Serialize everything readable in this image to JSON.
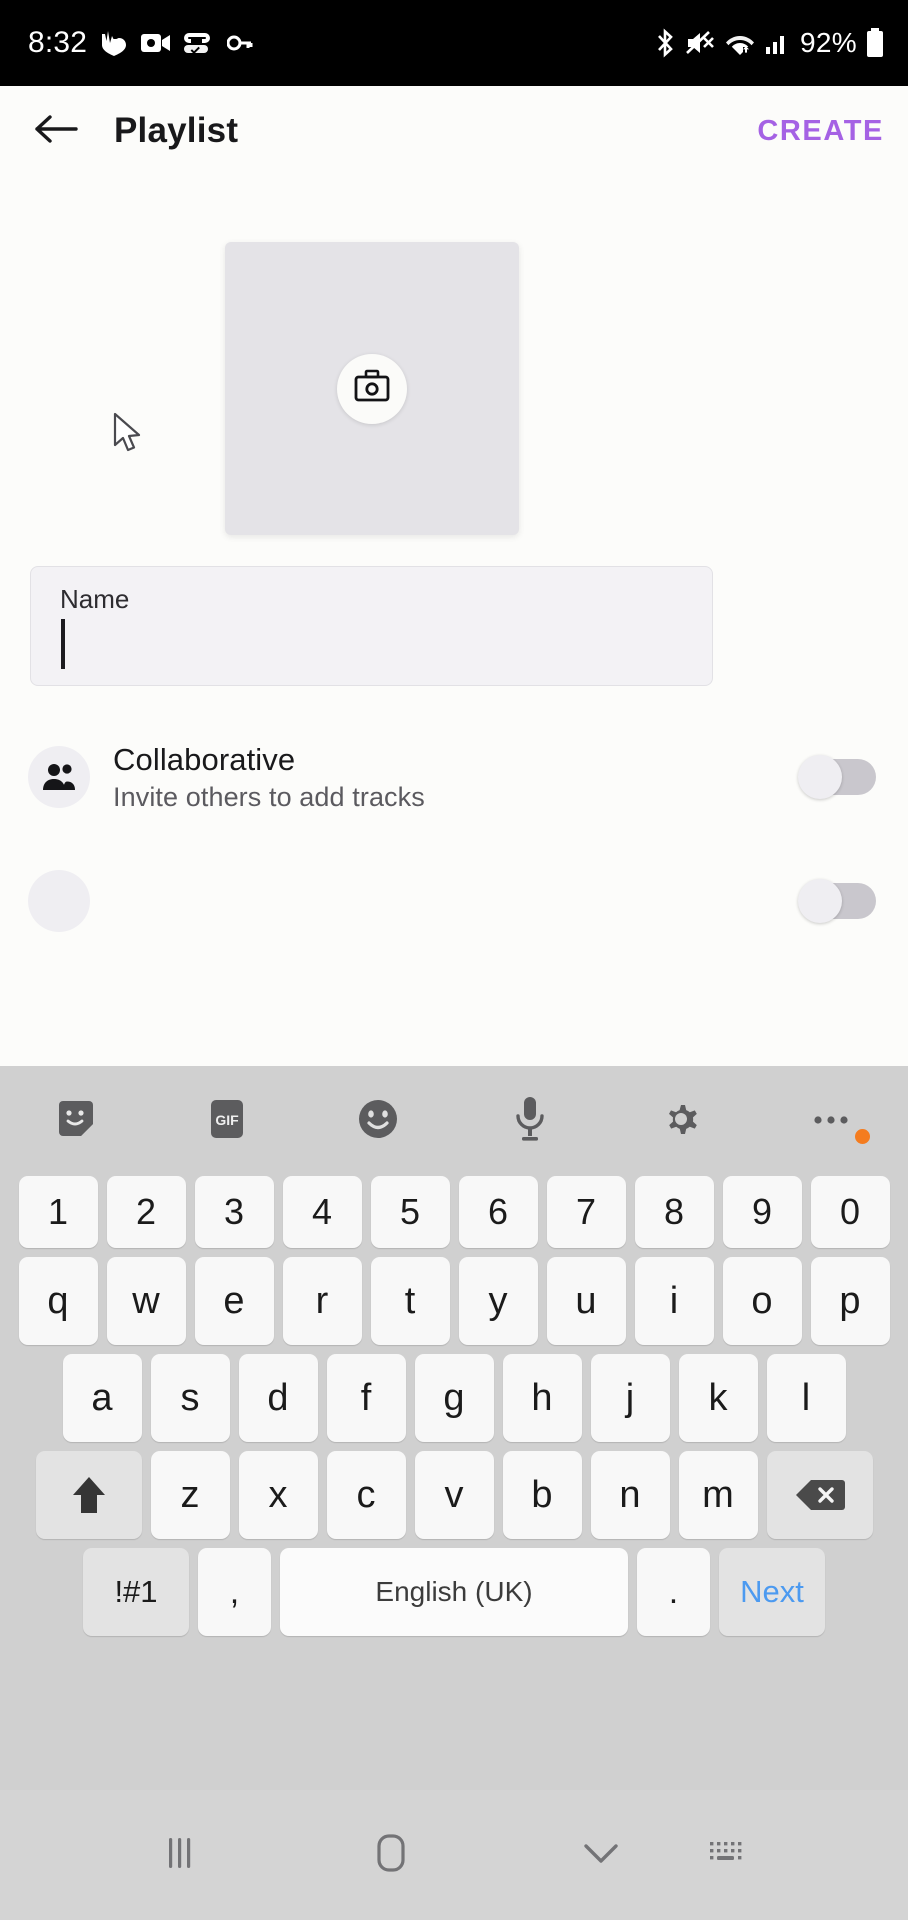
{
  "theme": {
    "accent": "#A562E4",
    "page_bg": "#FCFCFA",
    "cover_bg": "#E4E3E7",
    "field_bg": "#F3F2F5",
    "keyboard_bg": "#D0D0D0",
    "key_bg": "#F8F8F8",
    "key_fn_bg": "#E3E3E3",
    "navbar_bg": "#D4D4D4",
    "next_key_color": "#4C9AF0",
    "badge_dot": "#F47C1F"
  },
  "status_bar": {
    "time": "8:32",
    "battery_percent": "92%",
    "left_icons": [
      "heart-beat-icon",
      "video-camera-icon",
      "vpn-key-link-icon",
      "key-icon"
    ],
    "right_icons": [
      "bluetooth-icon",
      "mute-icon",
      "wifi-icon",
      "cellular-signal-icon"
    ],
    "battery_icon": "battery-icon"
  },
  "app_bar": {
    "back_icon": "back-arrow-icon",
    "title": "Playlist",
    "create_label": "CREATE"
  },
  "main": {
    "cover": {
      "name": "playlist-cover-placeholder",
      "camera_icon": "camera-icon"
    },
    "name_field": {
      "label": "Name",
      "value": "",
      "placeholder": "Name"
    },
    "options": [
      {
        "icon": "people-group-icon",
        "title": "Collaborative",
        "subtitle": "Invite others to add tracks",
        "toggle_on": false
      }
    ],
    "cursor": "mouse-pointer-icon"
  },
  "keyboard": {
    "toolbar": [
      {
        "icon": "sticker-icon",
        "label": ""
      },
      {
        "icon": "gif-icon",
        "label": "GIF"
      },
      {
        "icon": "emoji-icon",
        "label": ""
      },
      {
        "icon": "microphone-icon",
        "label": ""
      },
      {
        "icon": "settings-gear-icon",
        "label": ""
      },
      {
        "icon": "more-options-icon",
        "label": ""
      }
    ],
    "rows": {
      "numbers": [
        "1",
        "2",
        "3",
        "4",
        "5",
        "6",
        "7",
        "8",
        "9",
        "0"
      ],
      "top": [
        "q",
        "w",
        "e",
        "r",
        "t",
        "y",
        "u",
        "i",
        "o",
        "p"
      ],
      "home": [
        "a",
        "s",
        "d",
        "f",
        "g",
        "h",
        "j",
        "k",
        "l"
      ],
      "bottom": [
        "z",
        "x",
        "c",
        "v",
        "b",
        "n",
        "m"
      ]
    },
    "shift_key": "shift-icon",
    "backspace_key": "backspace-icon",
    "symbols_key": "!#1",
    "comma_key": ",",
    "space_key": "English (UK)",
    "period_key": ".",
    "action_key": "Next"
  },
  "nav_bar": {
    "recents": "recents-icon",
    "home": "home-icon",
    "dismiss_keyboard": "chevron-down-icon",
    "keyboard_switch": "keyboard-icon"
  }
}
